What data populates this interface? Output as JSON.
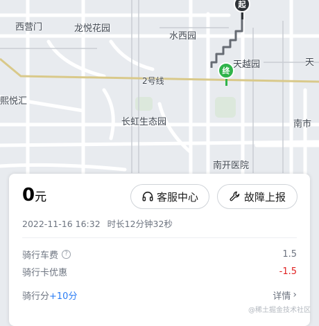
{
  "map": {
    "labels": {
      "xiyingmen": "西营门",
      "longyue": "龙悦花园",
      "shuixi": "水西园",
      "tianyue": "天越园",
      "tian": "天",
      "line2": "2号线",
      "xiyue": "熙悦汇",
      "changhong": "长虹生态园",
      "nankai_hospital": "南开医院",
      "nan_shi": "南市"
    },
    "start_marker": "起",
    "end_marker": "终",
    "colors": {
      "route": "#666b73",
      "start": "#2f3338",
      "end": "#2fb34a",
      "metro": "#d9c98a"
    }
  },
  "trip": {
    "amount": "0",
    "unit": "元",
    "service_button": "客服中心",
    "report_button": "故障上报",
    "time": "2022-11-16 16:32",
    "duration": "时长12分钟32秒"
  },
  "fees": {
    "ride_fee_label": "骑行车费",
    "ride_fee_value": "1.5",
    "card_discount_label": "骑行卡优惠",
    "card_discount_value": "-1.5",
    "points_label": "骑行分",
    "points_value": "+10分",
    "details_label": "详情"
  },
  "watermark": "@稀土掘金技术社区"
}
